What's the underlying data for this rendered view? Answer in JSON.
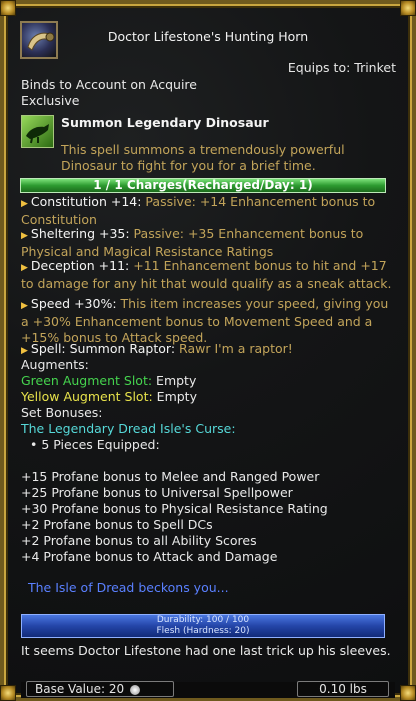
{
  "item": {
    "name": "Doctor Lifestone's Hunting Horn",
    "equips_to": "Equips to:  Trinket",
    "binds": "Binds to Account on Acquire",
    "exclusive": "Exclusive"
  },
  "spell": {
    "name": "Summon Legendary Dinosaur",
    "description": "This spell summons a tremendously powerful Dinosaur to fight for you for a brief time."
  },
  "charges": "1 / 1 Charges(Recharged/Day: 1)",
  "effects": [
    {
      "name": "Constitution +14:",
      "text": " Passive: +14 Enhancement bonus to Constitution"
    },
    {
      "name": "Sheltering +35:",
      "text": " Passive: +35 Enhancement bonus to Physical and Magical Resistance Ratings"
    },
    {
      "name": "Deception +11:",
      "text": " +11 Enhancement bonus to hit and +17 to damage for any hit that would qualify as a sneak attack."
    },
    {
      "name": "Speed +30%:",
      "text": " This item increases your speed, giving you a +30% Enhancement bonus to Movement Speed and a +15% bonus to Attack speed."
    },
    {
      "name": "Spell: Summon Raptor:",
      "text": " Rawr I'm a raptor!"
    }
  ],
  "augments": {
    "header": "Augments:",
    "green_slot": "Green Augment Slot:",
    "green_value": " Empty",
    "yellow_slot": "Yellow Augment Slot:",
    "yellow_value": " Empty"
  },
  "set_bonuses": {
    "header": "Set Bonuses:",
    "set_name": "The Legendary Dread Isle's Curse:",
    "pieces": "5 Pieces Equipped:",
    "bonuses": [
      "+15 Profane bonus to Melee and Ranged Power",
      "+25 Profane bonus to Universal Spellpower",
      "+30 Profane bonus to Physical Resistance Rating",
      "+2 Profane bonus to Spell DCs",
      "+2 Profane bonus to all Ability Scores",
      "+4 Profane bonus to Attack and Damage"
    ]
  },
  "flavor": "The Isle of Dread beckons you...",
  "durability": {
    "line1": "Durability: 100 / 100",
    "line2": "Flesh (Hardness: 20)",
    "fraction": 1.0
  },
  "lore": "It seems Doctor Lifestone had one last trick up his sleeves.",
  "footer": {
    "base_value": "Base Value: 20",
    "weight": "0.10 lbs"
  },
  "icons": [
    "horn-item-icon",
    "dinosaur-spell-icon",
    "silver-coin-icon"
  ]
}
